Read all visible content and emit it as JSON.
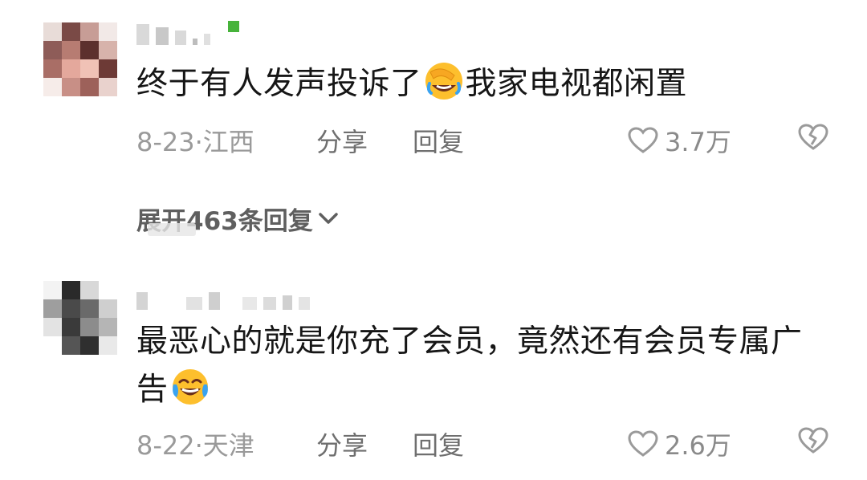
{
  "comments": [
    {
      "text_before": "终于有人发声投诉了",
      "emoji": "facepalm-laughing-emoji",
      "text_after": "我家电视都闲置",
      "date": "8-23",
      "separator": "·",
      "location": "江西",
      "share_label": "分享",
      "reply_label": "回复",
      "likes": "3.7万",
      "like_icon": "heart-outline-icon",
      "dislike_icon": "broken-heart-icon",
      "expand_label": "展开463条回复"
    },
    {
      "text_before": "最恶心的就是你充了会员，竟然还有会员专属广告",
      "emoji": "tears-of-joy-emoji",
      "text_after": "",
      "date": "8-22",
      "separator": "·",
      "location": "天津",
      "share_label": "分享",
      "reply_label": "回复",
      "likes": "2.6万",
      "like_icon": "heart-outline-icon",
      "dislike_icon": "broken-heart-icon"
    }
  ],
  "colors": {
    "text": "#161616",
    "meta": "#9a9a9a",
    "action": "#6f6f6f",
    "emoji_face": "#fdbf2d"
  }
}
